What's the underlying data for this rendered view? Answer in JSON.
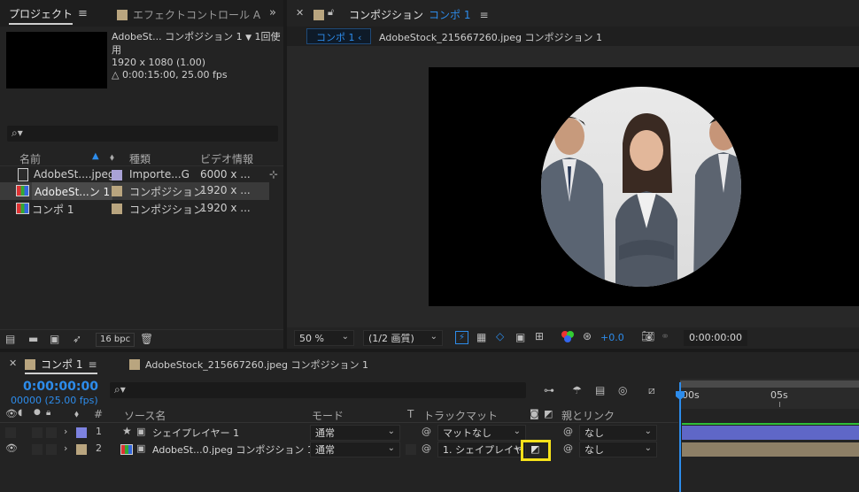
{
  "project_panel": {
    "tab_label": "プロジェクト",
    "menu_icon": "hamburger-icon",
    "effects_tab_label": "エフェクトコントロール A",
    "overflow_icon": "double-chevron-right-icon",
    "selected_item": {
      "name": "AdobeSt... コンポジション 1",
      "usage": "1回使用",
      "dims": "1920 x 1080 (1.00)",
      "duration": "△ 0:00:15:00, 25.00 fps"
    },
    "search_icon": "search-icon",
    "columns": {
      "name": "名前",
      "type": "種類",
      "video_info": "ビデオ情報"
    },
    "items": [
      {
        "name": "AdobeSt....jpeg",
        "type": "Importe...G",
        "info": "6000 x ...",
        "swatch": "#a9a2d6"
      },
      {
        "name": "AdobeSt...ン 1",
        "type": "コンポジション",
        "info": "1920 x ...",
        "swatch": "#b9a57f"
      },
      {
        "name": "コンポ 1",
        "type": "コンポジション",
        "info": "1920 x ...",
        "swatch": "#b9a57f"
      }
    ],
    "bit_depth": "16 bpc"
  },
  "comp_panel": {
    "tab_prefix": "コンポジション",
    "tab_comp": "コンポ 1",
    "breadcrumb_active": "コンポ 1",
    "breadcrumb_next": "AdobeStock_215667260.jpeg コンポジション 1",
    "zoom": "50 %",
    "resolution": "(1/2 画質)",
    "exposure": "+0.0",
    "timecode": "0:00:00:00"
  },
  "timeline": {
    "tab_label": "コンポ 1",
    "tab2_label": "AdobeStock_215667260.jpeg コンポジション 1",
    "timecode": "0:00:00:00",
    "frame_info": "00000 (25.00 fps)",
    "columns": {
      "hash": "#",
      "source": "ソース名",
      "mode": "モード",
      "t": "T",
      "track_matte": "トラックマット",
      "parent": "親とリンク"
    },
    "ruler": {
      "start": "00s",
      "mark": "05s"
    },
    "layers": [
      {
        "num": "1",
        "name": "シェイプレイヤー 1",
        "mode": "通常",
        "matte": "マットなし",
        "parent": "なし",
        "swatch": "#7d82e0",
        "bar": "#5f67c7"
      },
      {
        "num": "2",
        "name": "AdobeSt...0.jpeg コンポジション 1",
        "mode": "通常",
        "matte": "1. シェイプレイヤ",
        "parent": "なし",
        "swatch": "#b9a57f",
        "bar": "#8d7f66"
      }
    ]
  },
  "colors": {
    "accent": "#2d8ceb",
    "highlight": "#f5e11a"
  }
}
